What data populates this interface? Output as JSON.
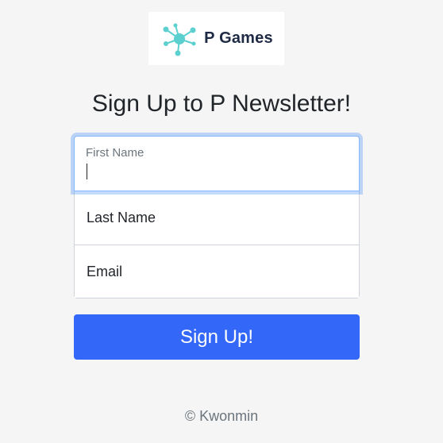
{
  "logo": {
    "text": "P Games",
    "icon": "network-nodes-icon",
    "icon_color": "#5ccfcf"
  },
  "title": "Sign Up to P Newsletter!",
  "form": {
    "first_name": {
      "label": "First Name",
      "value": "",
      "focused": true
    },
    "last_name": {
      "placeholder": "Last Name",
      "value": ""
    },
    "email": {
      "placeholder": "Email",
      "value": ""
    }
  },
  "submit_label": "Sign Up!",
  "footer": {
    "text": "© Kwonmin"
  },
  "colors": {
    "background": "#f5f5f5",
    "button": "#3367f7",
    "focus_ring": "#86b7fe",
    "brand_text": "#1e2a44"
  }
}
